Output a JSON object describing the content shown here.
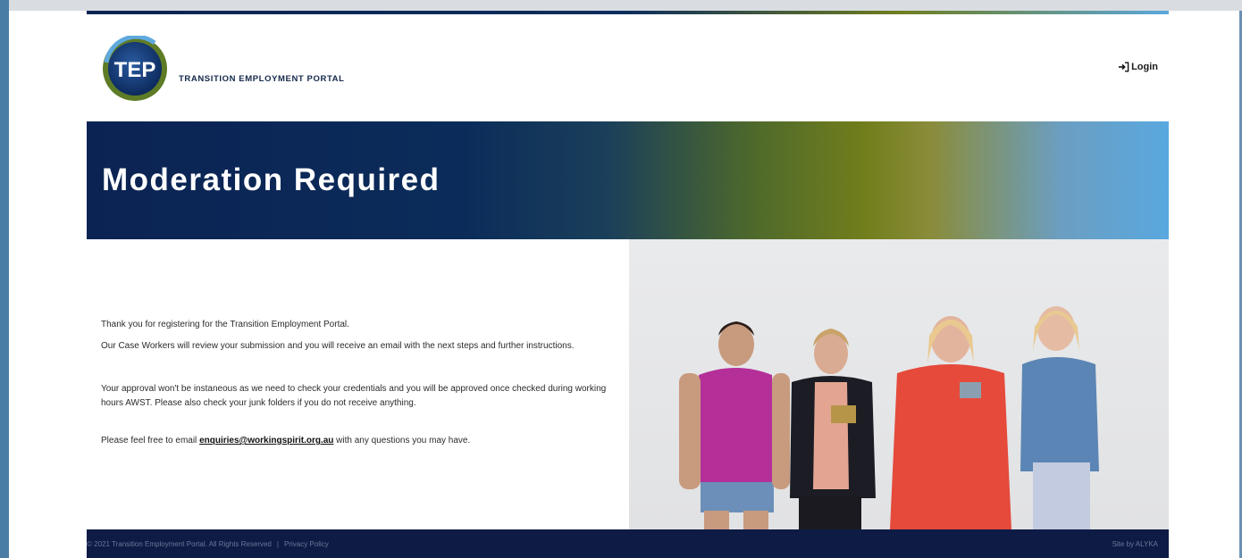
{
  "header": {
    "logo_initials": "TEP",
    "brand_name": "TRANSITION EMPLOYMENT PORTAL",
    "login_label": "Login",
    "login_icon": "sign-in-icon"
  },
  "hero": {
    "title": "Moderation Required"
  },
  "message": {
    "p1": "Thank you for registering for the Transition Employment Portal.",
    "p2": "Our Case Workers will review your submission and you will receive an email with the next steps and further instructions.",
    "p3": "Your approval won't be instaneous as we need to check your credentials and you will be approved once checked during working hours AWST. Please also check your junk folders if you do not receive anything.",
    "p4_before": "Please feel free to email ",
    "email": "enquiries@workingspirit.org.au",
    "p4_after": " with any questions you may have."
  },
  "footer": {
    "copyright": "© 2021 Transition Employment Portal. All Rights Reserved",
    "privacy": "Privacy Policy",
    "credit": "Site by ALYKA"
  },
  "colors": {
    "navy": "#0b2353",
    "olive": "#727e1c",
    "sky": "#59a8e0",
    "footer": "#0d1b45"
  }
}
